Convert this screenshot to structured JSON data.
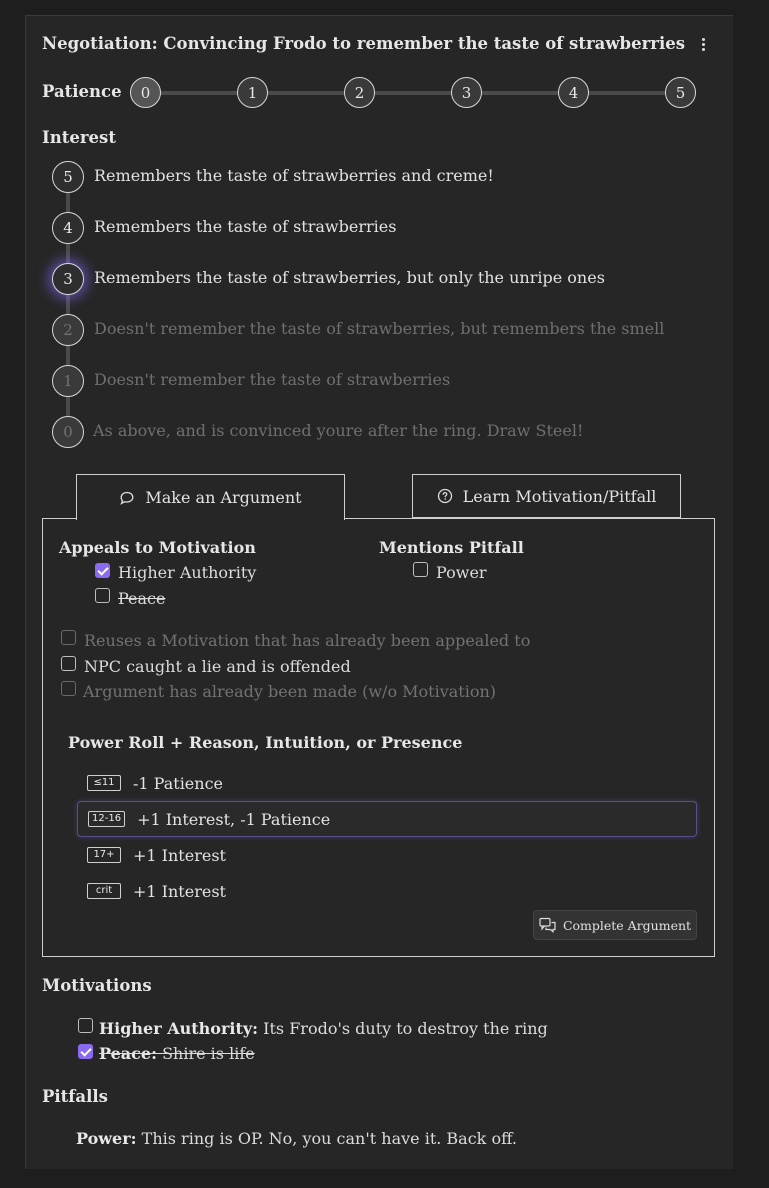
{
  "header": {
    "title": "Negotiation: Convincing Frodo to remember the taste of strawberries",
    "menu_icon": "more-vertical-icon"
  },
  "patience": {
    "label": "Patience",
    "nodes": [
      "0",
      "1",
      "2",
      "3",
      "4",
      "5"
    ]
  },
  "interest": {
    "label": "Interest",
    "current": "3",
    "levels": [
      {
        "value": "5",
        "text": "Remembers the taste of strawberries and creme!"
      },
      {
        "value": "4",
        "text": "Remembers the taste of strawberries"
      },
      {
        "value": "3",
        "text": "Remembers the taste of strawberries, but only the unripe ones"
      },
      {
        "value": "2",
        "text": "Doesn't remember the taste of strawberries, but remembers the smell"
      },
      {
        "value": "1",
        "text": "Doesn't remember the taste of strawberries"
      },
      {
        "value": "0",
        "text": "As above, and is convinced youre after the ring. Draw Steel!"
      }
    ]
  },
  "tabs": [
    {
      "label": "Make an Argument",
      "icon": "speech-bubble-icon",
      "active": true
    },
    {
      "label": "Learn Motivation/Pitfall",
      "icon": "question-circle-icon",
      "active": false
    }
  ],
  "argument": {
    "appeals_label": "Appeals to Motivation",
    "appeals": [
      {
        "label": "Higher Authority",
        "checked": true
      },
      {
        "label": "Peace",
        "checked": false
      }
    ],
    "pitfall_label": "Mentions Pitfall",
    "pitfalls": [
      {
        "label": "Power",
        "checked": false
      }
    ],
    "modifiers": [
      {
        "label": "Reuses a Motivation that has already been appealed to",
        "checked": false
      },
      {
        "label": "NPC caught a lie and is offended",
        "checked": false
      },
      {
        "label": "Argument has already been made (w/o Motivation)",
        "checked": false
      }
    ],
    "roll_label": "Power Roll + Reason, Intuition, or Presence",
    "outcomes": [
      {
        "tier": "≤11",
        "effect": "-1 Patience"
      },
      {
        "tier": "12-16",
        "effect": "+1 Interest, -1 Patience"
      },
      {
        "tier": "17+",
        "effect": "+1 Interest"
      },
      {
        "tier": "crit",
        "effect": "+1 Interest"
      }
    ],
    "complete_label": "Complete Argument"
  },
  "motivations": {
    "label": "Motivations",
    "items": [
      {
        "name": "Higher Authority:",
        "desc": "Its Frodo's duty to destroy the ring",
        "checked": false
      },
      {
        "name": "Peace:",
        "desc": "Shire is life",
        "checked": true
      }
    ]
  },
  "pitfalls": {
    "label": "Pitfalls",
    "items": [
      {
        "name": "Power:",
        "desc": "This ring is OP. No, you can't have it. Back off."
      }
    ]
  },
  "colors": {
    "accent": "#8a6af0",
    "card_bg": "#262626",
    "page_bg": "#1e1e1e"
  }
}
